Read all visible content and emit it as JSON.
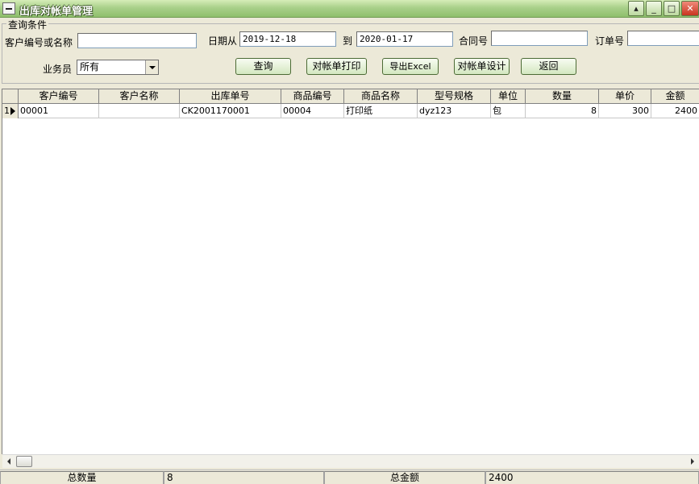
{
  "window": {
    "title": "出库对帐单管理"
  },
  "query": {
    "legend": "查询条件",
    "customer_label": "客户编号或名称",
    "customer_value": "",
    "date_from_label": "日期从",
    "date_from": "2019-12-18",
    "date_to_label": "到",
    "date_to": "2020-01-17",
    "contract_label": "合同号",
    "contract_value": "",
    "order_label": "订单号",
    "order_value": "",
    "salesman_label": "业务员",
    "salesman_value": "所有"
  },
  "buttons": {
    "search": "查询",
    "print": "对帐单打印",
    "export": "导出Excel",
    "design": "对帐单设计",
    "back": "返回"
  },
  "grid": {
    "columns": [
      "客户编号",
      "客户名称",
      "出库单号",
      "商品编号",
      "商品名称",
      "型号规格",
      "单位",
      "数量",
      "单价",
      "金额"
    ],
    "rows": [
      {
        "index": "1",
        "cells": [
          "00001",
          "",
          "CK2001170001",
          "00004",
          "打印纸",
          "dyz123",
          "包",
          "8",
          "300",
          "2400"
        ]
      }
    ]
  },
  "status": {
    "total_qty_label": "总数量",
    "total_qty": "8",
    "total_amount_label": "总金额",
    "total_amount": "2400"
  },
  "icons": {
    "system_menu": "window-menu-icon",
    "minimize": "minimize-icon",
    "maximize": "maximize-icon",
    "close": "close-icon",
    "row_pointer": "row-pointer-icon"
  }
}
